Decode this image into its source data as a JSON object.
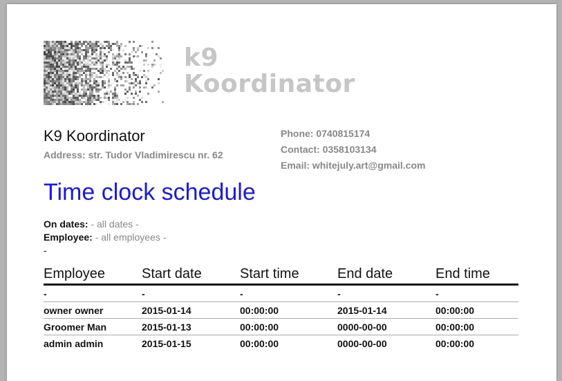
{
  "logo": {
    "text_line1": "k9",
    "text_line2": "Koordinator"
  },
  "company": {
    "name": "K9 Koordinator",
    "address": "Address: str. Tudor Vladimirescu nr. 62",
    "phone": "Phone: 0740815174",
    "contact": "Contact: 0358103134",
    "email": "Email: whitejuly.art@gmail.com"
  },
  "document": {
    "title": "Time clock schedule"
  },
  "filters": {
    "dates_label": "On dates:",
    "dates_value": "- all dates -",
    "employee_label": "Employee:",
    "employee_value": "- all employees -",
    "extra": "-"
  },
  "table": {
    "headers": [
      "Employee",
      "Start date",
      "Start time",
      "End date",
      "End time"
    ],
    "rows": [
      [
        "-",
        "-",
        "-",
        "-",
        "-"
      ],
      [
        "owner owner",
        "2015-01-14",
        "00:00:00",
        "2015-01-14",
        "00:00:00"
      ],
      [
        "Groomer Man",
        "2015-01-13",
        "00:00:00",
        "0000-00-00",
        "00:00:00"
      ],
      [
        "admin admin",
        "2015-01-15",
        "00:00:00",
        "0000-00-00",
        "00:00:00"
      ]
    ]
  },
  "colors": {
    "title": "#1a1ad6",
    "muted": "#888888",
    "logo_text": "#c6c6c6"
  }
}
